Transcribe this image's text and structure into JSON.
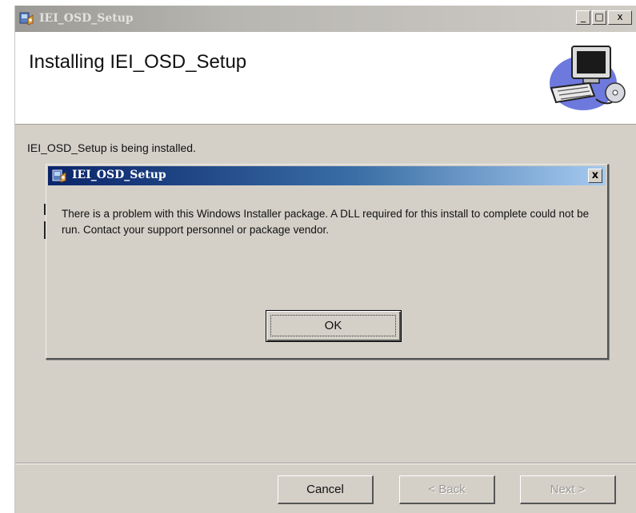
{
  "window": {
    "title": "IEI_OSD_Setup",
    "minimize_glyph": "_",
    "maximize_glyph": "□",
    "close_glyph": "x"
  },
  "header": {
    "title": "Installing IEI_OSD_Setup",
    "graphic_icon": "computer-setup-icon"
  },
  "main": {
    "status_text": "IEI_OSD_Setup is being installed."
  },
  "dialog": {
    "title": "IEI_OSD_Setup",
    "close_glyph": "x",
    "message": "There is a problem with this Windows Installer package. A DLL required for this install to complete could not be run. Contact your support personnel or package vendor.",
    "ok_label": "OK"
  },
  "footer": {
    "cancel_label": "Cancel",
    "back_label": "< Back",
    "next_label": "Next >"
  },
  "colors": {
    "dialog_titlebar_start": "#0a246a",
    "dialog_titlebar_end": "#a6caf0",
    "face": "#d4d0c8"
  }
}
